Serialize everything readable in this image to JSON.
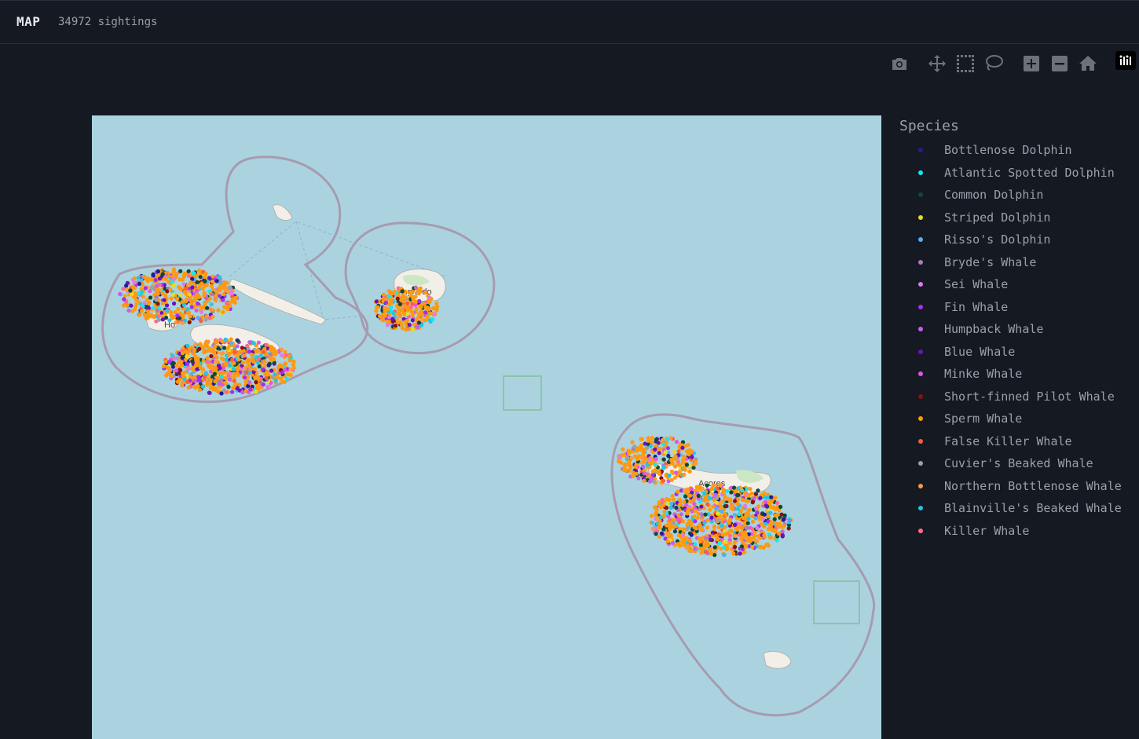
{
  "header": {
    "title": "MAP",
    "count_label": "34972 sightings"
  },
  "modebar": {
    "buttons": [
      "camera-icon",
      "pan-icon",
      "box-select-icon",
      "lasso-select-icon",
      "zoom-in-icon",
      "zoom-out-icon",
      "home-icon"
    ]
  },
  "map": {
    "place_labels": [
      {
        "text": "Angra do",
        "island": "Terceira"
      },
      {
        "text": "Ho",
        "island": "Faial"
      },
      {
        "text": "Açores",
        "island": "São Miguel"
      },
      {
        "text": "da",
        "island": "São Miguel"
      }
    ],
    "colors": {
      "sea": "#aad3df",
      "land": "#f2efe9",
      "land_green": "#cde6c4",
      "eez": "#a79bb1"
    }
  },
  "legend": {
    "title": "Species",
    "items": [
      {
        "label": "Bottlenose Dolphin",
        "color": "#1f1f8f"
      },
      {
        "label": "Atlantic Spotted Dolphin",
        "color": "#17e8f0"
      },
      {
        "label": "Common Dolphin",
        "color": "#0b4a3a"
      },
      {
        "label": "Striped Dolphin",
        "color": "#e6e01a"
      },
      {
        "label": "Risso's Dolphin",
        "color": "#4fb3f0"
      },
      {
        "label": "Bryde's Whale",
        "color": "#b07ab6"
      },
      {
        "label": "Sei Whale",
        "color": "#e07ae8"
      },
      {
        "label": "Fin Whale",
        "color": "#a030f0"
      },
      {
        "label": "Humpback Whale",
        "color": "#c060f0"
      },
      {
        "label": "Blue Whale",
        "color": "#6a10c0"
      },
      {
        "label": "Minke Whale",
        "color": "#e055e0"
      },
      {
        "label": "Short-finned Pilot Whale",
        "color": "#8a1010"
      },
      {
        "label": "Sperm Whale",
        "color": "#ff9a10"
      },
      {
        "label": "False Killer Whale",
        "color": "#ff5a3a"
      },
      {
        "label": "Cuvier's Beaked Whale",
        "color": "#9aa0a8"
      },
      {
        "label": "Northern Bottlenose Whale",
        "color": "#ff9a40"
      },
      {
        "label": "Blainville's Beaked Whale",
        "color": "#20c8e0"
      },
      {
        "label": "Killer Whale",
        "color": "#ff6a8a"
      }
    ]
  }
}
